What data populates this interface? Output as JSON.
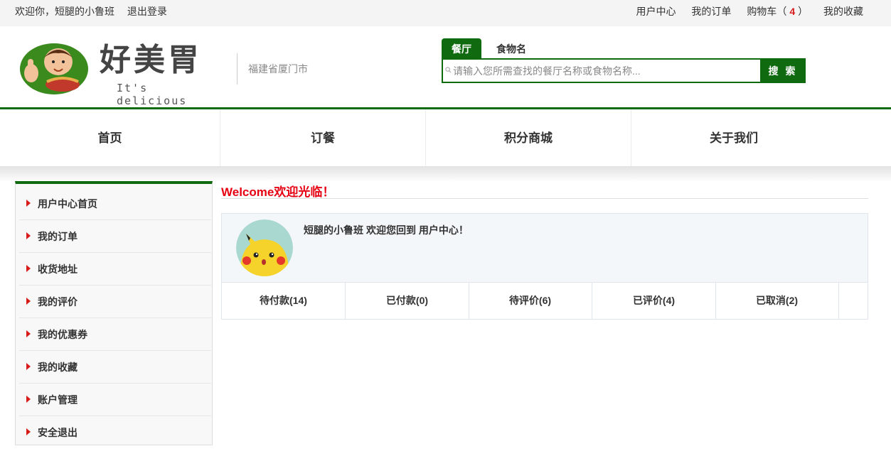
{
  "topbar": {
    "greeting": "欢迎你，短腿的小鲁班",
    "logout": "退出登录",
    "links": {
      "user_center": "用户中心",
      "my_orders": "我的订单",
      "cart_label": "购物车",
      "cart_open": "（",
      "cart_count": "4",
      "cart_close": "）",
      "favorites": "我的收藏"
    }
  },
  "header": {
    "brand": "好美胃",
    "slogan": "It's delicious",
    "location": "福建省厦门市",
    "search": {
      "tabs": [
        "餐厅",
        "食物名"
      ],
      "placeholder": "请输入您所需查找的餐厅名称或食物名称...",
      "button": "搜 索"
    }
  },
  "nav": {
    "items": [
      "首页",
      "订餐",
      "积分商城",
      "关于我们"
    ]
  },
  "sidebar": {
    "items": [
      "用户中心首页",
      "我的订单",
      "收货地址",
      "我的评价",
      "我的优惠券",
      "我的收藏",
      "账户管理",
      "安全退出"
    ]
  },
  "main": {
    "welcome": "Welcome欢迎光临！",
    "username": "短腿的小鲁班",
    "message": "欢迎您回到 用户中心！",
    "stats": [
      "待付款(14)",
      "已付款(0)",
      "待评价(6)",
      "已评价(4)",
      "已取消(2)"
    ]
  },
  "colors": {
    "brand_green": "#106a10",
    "accent_red": "#e60012"
  }
}
